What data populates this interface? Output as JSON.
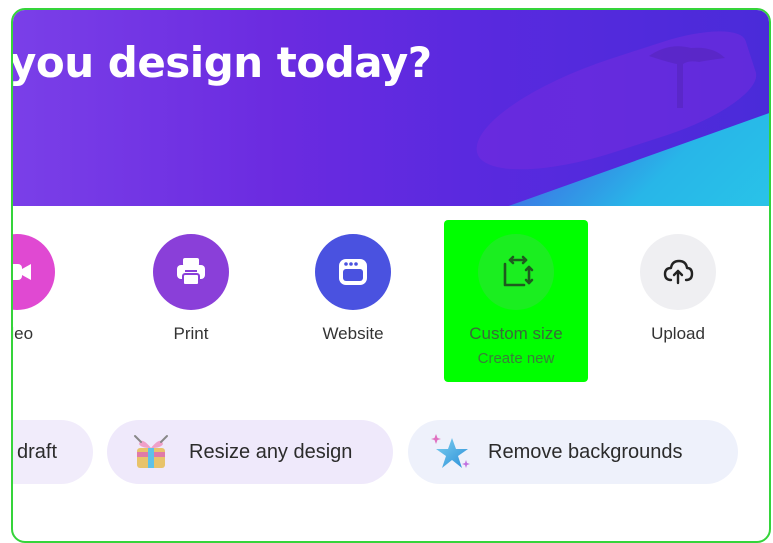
{
  "hero": {
    "title": "you design today?"
  },
  "shortcuts": [
    {
      "label": "ideo",
      "icon": "video-icon",
      "color": "#e049d2"
    },
    {
      "label": "Print",
      "icon": "printer-icon",
      "color": "#8a3fd9"
    },
    {
      "label": "Website",
      "icon": "browser-window-icon",
      "color": "#4a52e0"
    },
    {
      "label": "Custom size",
      "sublabel": "Create new",
      "icon": "custom-size-icon",
      "color": "#1bee20"
    },
    {
      "label": "Upload",
      "icon": "cloud-upload-icon",
      "color": "#efeff2"
    }
  ],
  "pills": [
    {
      "label": "draft"
    },
    {
      "label": "Resize any design",
      "icon": "resize-gift-icon"
    },
    {
      "label": "Remove backgrounds",
      "icon": "sparkle-star-icon"
    }
  ],
  "colors": {
    "hero_purple": "#6b2be0",
    "hero_teal": "#29c5e8",
    "highlight": "#00ff00",
    "frame_border": "#35d43a"
  }
}
